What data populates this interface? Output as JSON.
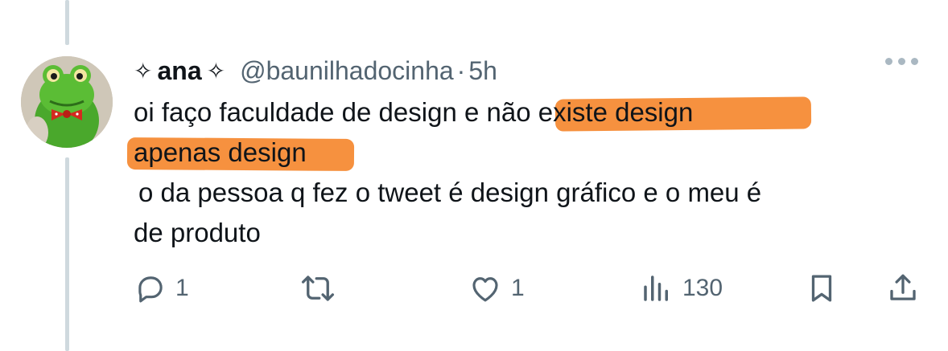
{
  "author": {
    "display_name": "ana",
    "decoration": "✧",
    "handle": "@baunilhadocinha",
    "separator": "·",
    "time": "5h"
  },
  "tweet": {
    "line1_plain": "oi faço faculdade de design e ",
    "line1_highlight": "não existe design",
    "line2_highlight": "apenas design",
    "line3": "o da pessoa q fez o tweet é design gráfico e o meu é",
    "line4": "de produto",
    "highlight_color": "#f68b35"
  },
  "actions": {
    "reply_count": "1",
    "like_count": "1",
    "views_count": "130"
  },
  "icons": [
    "reply-icon",
    "retweet-icon",
    "like-icon",
    "views-icon",
    "bookmark-icon",
    "share-icon",
    "more-icon"
  ]
}
